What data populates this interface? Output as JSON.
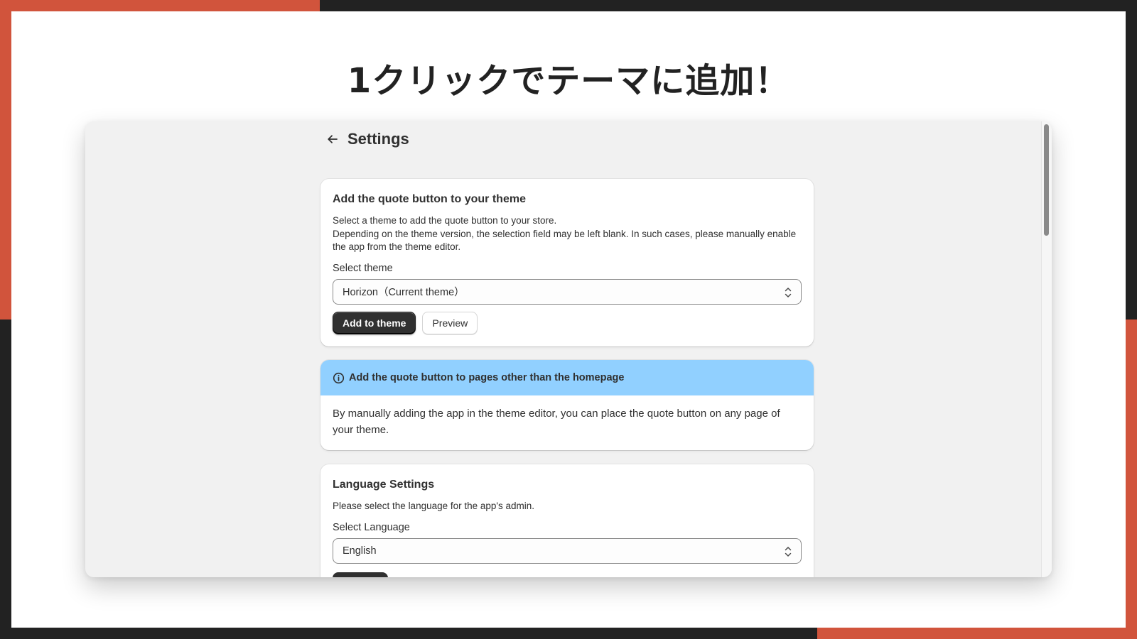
{
  "slide": {
    "headline": "1クリックでテーマに追加！",
    "colors": {
      "accent": "#d1543c",
      "frame_dark": "#222222",
      "window_bg": "#f1f1f1",
      "banner_bg": "#91d0ff",
      "primary_button": "#303030"
    }
  },
  "header": {
    "title": "Settings",
    "back_icon": "arrow-left-icon"
  },
  "theme_card": {
    "title": "Add the quote button to your theme",
    "description_line1": "Select a theme to add the quote button to your store.",
    "description_line2": "Depending on the theme version, the selection field may be left blank. In such cases, please manually enable the app from the theme editor.",
    "select_label": "Select theme",
    "select_value": "Horizon（Current theme）",
    "select_icon": "chevron-up-down-icon",
    "primary_button": "Add to theme",
    "secondary_button": "Preview"
  },
  "info_banner": {
    "icon": "info-circle-icon",
    "title": "Add the quote button to pages other than the homepage",
    "body": "By manually adding the app in the theme editor, you can place the quote button on any page of your theme."
  },
  "language_card": {
    "title": "Language Settings",
    "description": "Please select the language for the app's admin.",
    "select_label": "Select Language",
    "select_value": "English",
    "select_icon": "chevron-up-down-icon"
  }
}
